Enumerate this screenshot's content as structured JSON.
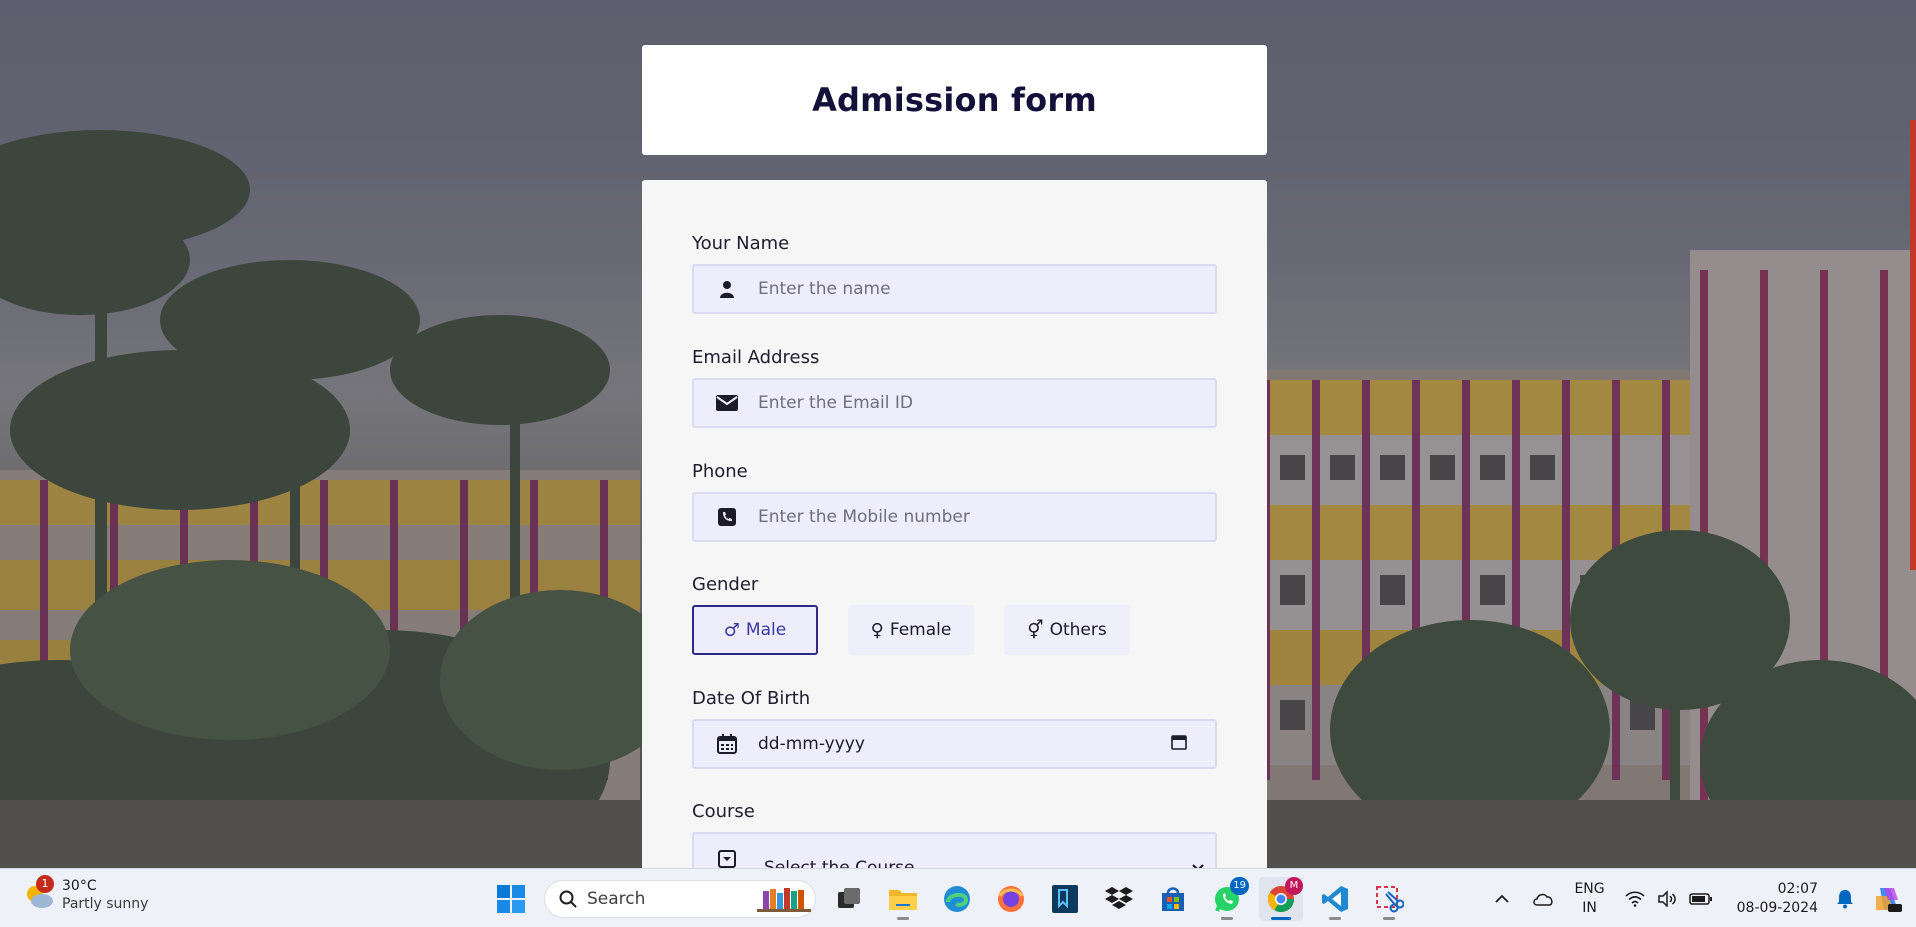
{
  "form": {
    "title": "Admission form",
    "name": {
      "label": "Your Name",
      "placeholder": "Enter the name",
      "icon": "user-icon"
    },
    "email": {
      "label": "Email Address",
      "placeholder": "Enter the Email ID",
      "icon": "envelope-icon"
    },
    "phone": {
      "label": "Phone",
      "placeholder": "Enter the Mobile number",
      "icon": "phone-icon"
    },
    "gender": {
      "label": "Gender",
      "options": [
        {
          "label": "Male",
          "symbol": "♂",
          "selected": true
        },
        {
          "label": "Female",
          "symbol": "♀",
          "selected": false
        },
        {
          "label": "Others",
          "symbol": "⚥",
          "selected": false
        }
      ]
    },
    "dob": {
      "label": "Date Of Birth",
      "value": "dd-mm-yyyy",
      "icon": "calendar-icon"
    },
    "course": {
      "label": "Course",
      "value": "Select the Course",
      "icon": "dropdown-box-icon"
    }
  },
  "taskbar": {
    "weather": {
      "badge": "1",
      "temp": "30°C",
      "desc": "Partly sunny"
    },
    "search_label": "Search",
    "apps": [
      {
        "name": "start",
        "icon": "windows-start-icon"
      },
      {
        "name": "task-view",
        "icon": "task-view-icon"
      },
      {
        "name": "file-explorer",
        "icon": "folder-icon"
      },
      {
        "name": "edge",
        "icon": "edge-icon"
      },
      {
        "name": "firefox",
        "icon": "firefox-icon"
      },
      {
        "name": "app-blue",
        "icon": "bookmark-app-icon"
      },
      {
        "name": "dropbox",
        "icon": "dropbox-icon"
      },
      {
        "name": "store",
        "icon": "store-icon"
      },
      {
        "name": "whatsapp",
        "icon": "whatsapp-icon",
        "badge": "19"
      },
      {
        "name": "chrome",
        "icon": "chrome-icon",
        "badge": "M"
      },
      {
        "name": "vscode",
        "icon": "vscode-icon"
      },
      {
        "name": "snipping-tool",
        "icon": "snipping-tool-icon"
      }
    ],
    "lang": {
      "line1": "ENG",
      "line2": "IN"
    },
    "clock": {
      "time": "02:07",
      "date": "08-09-2024"
    }
  },
  "colors": {
    "accent": "#2d2a86",
    "title": "#13113a",
    "input_bg": "#eeedfc",
    "card_bg": "#f7f6f7"
  }
}
